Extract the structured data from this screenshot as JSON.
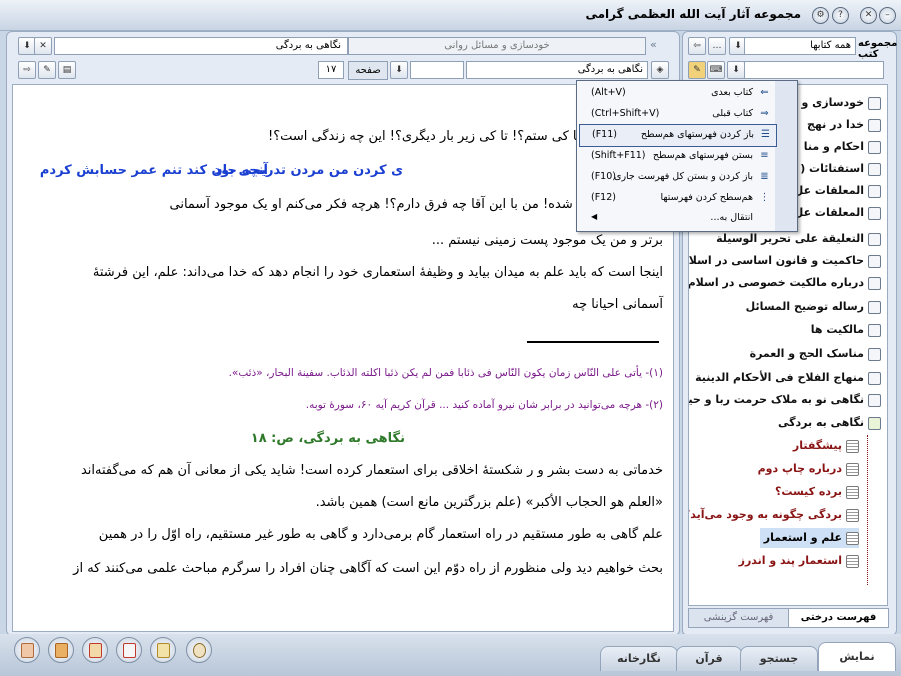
{
  "window": {
    "title": "مجموعه آثار آیت الله العظمی گرامی"
  },
  "reader": {
    "book_tab": "نگاهی به بردگی",
    "section_tab": "خودسازی و مسائل روانی",
    "path_value": "نگاهی به بردگی",
    "page_label": "صفحه",
    "page_number": "۱۷"
  },
  "content": {
    "l1": "ه فکر می‌افتد: تا کی ستم؟! تا کی زیر بار دیگری؟! این چه زندگی است؟!",
    "poem_right": "ی کردن من مردن تدریجی بود",
    "poem_left": "آنچه جان کند تنم عمر حسابش کردم",
    "l3": "ر استثمار خلاص شده! من با این آقا چه فرق دارم؟! هرچه فکر می‌کنم او یک موجود آسمانی",
    "l4": "برتر و من یک موجود پست زمینی نیستم ...",
    "l5": "اینجا است که باید علم به میدان بیاید و وظیفهٔ استعماری خود را انجام دهد که خدا می‌داند: علم، این فرشتهٔ",
    "l6": "آسمانی احیانا چه",
    "fn1": "(۱)- یأتی علی النّاس زمان یکون النّاس فی ذئابا فمن لم یکن ذئبا اکلته الذئاب. سفینة البحار، «ذئب».",
    "fn2": "(۲)- هرچه می‌توانید در برابر شان نیرو آماده کنید ... قرآن کریم آیه ۶۰، سورهٔ توبه.",
    "page_head": "نگاهی به بردگی، ص: ۱۸",
    "p1": "خدماتی به دست بشر و ر شکستهٔ اخلاقی برای استعمار کرده است! شاید یکی از معانی آن هم که می‌گفته‌اند",
    "p2": "«العلم هو الحجاب الأکبر» (علم بزرگترین مانع است) همین باشد.",
    "p3": "علم گاهی به طور مستقیم در راه استعمار گام برمی‌دارد و گاهی به طور غیر مستقیم، راه اوّل را در همین",
    "p4": "بحث خواهیم دید ولی منظورم از راه دوّم این است که آگاهی چنان افراد را سرگرم مباحث علمی می‌کنند که از"
  },
  "sidebar": {
    "label": "مجموعه کتب",
    "combo": "همه کتابها",
    "tree": [
      "خودسازی و",
      "خدا در نهج",
      "احکام و منا",
      "استفتائات (",
      "المعلقات عل",
      "المعلقات عل",
      "التعلیقة علی تحریر الوسیلة",
      "حاکمیت و قانون اساسی در اسلام",
      "درباره مالکیت خصوصی در اسلام",
      "رساله توضیح المسائل",
      "مالکیت ها",
      "مناسک الحج و العمرة",
      "منهاج الفلاح فی الأحکام الدینیة",
      "نگاهی نو به ملاک حرمت ربا و حیل",
      "نگاهی به بردگی"
    ],
    "children": [
      "پیشگفتار",
      "درباره چاپ دوم",
      "برده کیست؟",
      "بردگی چگونه به وجود می‌آید؟",
      "علم و استعمار",
      "استعمار پند و اندرز"
    ],
    "tab_tree": "فهرست درختی",
    "tab_select": "فهرست گزینشی"
  },
  "menu": {
    "items": [
      {
        "label": "کتاب بعدی",
        "shortcut": "(Alt+V)",
        "icon": "next-book-icon"
      },
      {
        "label": "کتاب قبلی",
        "shortcut": "(Ctrl+Shift+V)",
        "icon": "prev-book-icon"
      },
      {
        "label": "باز کردن فهرستهای هم‌سطح",
        "shortcut": "(F11)",
        "icon": "expand-level-icon"
      },
      {
        "label": "بستن فهرستهای هم‌سطح",
        "shortcut": "(Shift+F11)",
        "icon": "collapse-level-icon"
      },
      {
        "label": "باز کردن و بستن کل فهرست جاری",
        "shortcut": "(F10)",
        "icon": "toggle-all-icon"
      },
      {
        "label": "هم‌سطح کردن فهرستها",
        "shortcut": "(F12)",
        "icon": "align-level-icon"
      },
      {
        "label": "انتقال به...",
        "shortcut": "",
        "icon": "move-icon"
      }
    ]
  },
  "bottom": {
    "tabs": [
      "نمایش",
      "جستجو",
      "قرآن",
      "نگارخانه"
    ]
  }
}
